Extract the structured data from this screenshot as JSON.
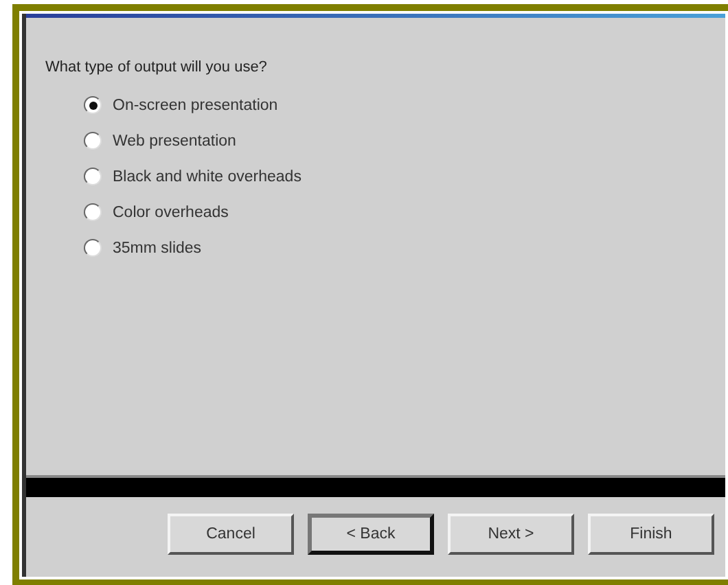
{
  "question": "What type of output will you use?",
  "options": [
    {
      "label": "On-screen presentation",
      "selected": true
    },
    {
      "label": "Web presentation",
      "selected": false
    },
    {
      "label": "Black and white overheads",
      "selected": false
    },
    {
      "label": "Color overheads",
      "selected": false
    },
    {
      "label": "35mm slides",
      "selected": false
    }
  ],
  "buttons": [
    {
      "label": "Cancel",
      "default": false
    },
    {
      "label": "< Back",
      "default": true
    },
    {
      "label": "Next >",
      "default": false
    },
    {
      "label": "Finish",
      "default": false
    }
  ]
}
